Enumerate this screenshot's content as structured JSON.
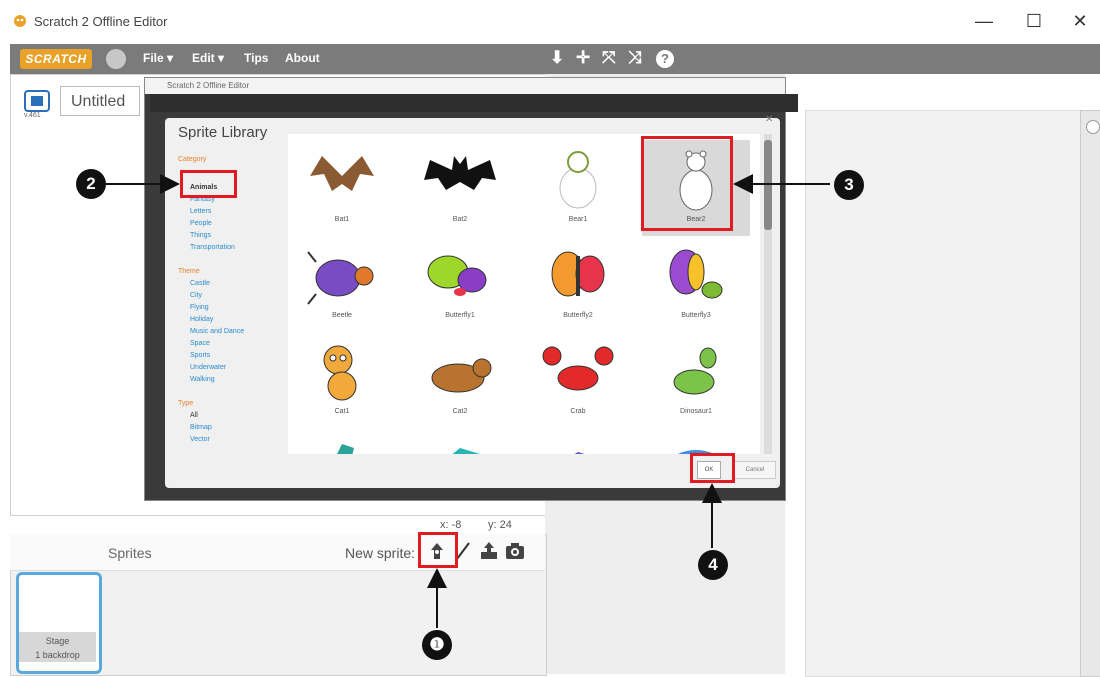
{
  "window": {
    "title": "Scratch 2 Offline Editor",
    "controls": [
      "—",
      "☐",
      "✕"
    ]
  },
  "menubar": {
    "logo": "SCRATCH",
    "items": [
      "File ▾",
      "Edit ▾",
      "Tips",
      "About"
    ],
    "tools": [
      "⬇",
      "✛",
      "⤧",
      "⤨",
      "?"
    ]
  },
  "project": {
    "title": "Untitled",
    "version": "v.461"
  },
  "inner_window": {
    "title": "Scratch 2 Offline Editor"
  },
  "dialog": {
    "title": "Sprite Library",
    "close": "✕",
    "categories": {
      "category_header": "Category",
      "category_items": [
        "Animals",
        "Fantasy",
        "Letters",
        "People",
        "Things",
        "Transportation"
      ],
      "theme_header": "Theme",
      "theme_items": [
        "Castle",
        "City",
        "Flying",
        "Holiday",
        "Music and Dance",
        "Space",
        "Sports",
        "Underwater",
        "Walking"
      ],
      "type_header": "Type",
      "type_items": [
        "All",
        "Bitmap",
        "Vector"
      ]
    },
    "sprites": [
      {
        "name": "Bat1",
        "icon": "bat-brown"
      },
      {
        "name": "Bat2",
        "icon": "bat-black"
      },
      {
        "name": "Bear1",
        "icon": "bear-outline"
      },
      {
        "name": "Bear2",
        "icon": "bear-white"
      },
      {
        "name": "Beetle",
        "icon": "beetle"
      },
      {
        "name": "Butterfly1",
        "icon": "butterfly-green"
      },
      {
        "name": "Butterfly2",
        "icon": "butterfly-orange"
      },
      {
        "name": "Butterfly3",
        "icon": "butterfly-purple"
      },
      {
        "name": "Cat1",
        "icon": "cat"
      },
      {
        "name": "Cat2",
        "icon": "cat-brown"
      },
      {
        "name": "Crab",
        "icon": "crab"
      },
      {
        "name": "Dinosaur1",
        "icon": "dinosaur"
      }
    ],
    "ok_label": "OK",
    "cancel_label": "Cancel"
  },
  "coords": {
    "x": "x: -8",
    "y": "y: 24"
  },
  "sprites_panel": {
    "label": "Sprites",
    "new_sprite_label": "New sprite:",
    "stage_label": "Stage",
    "stage_sub": "1 backdrop"
  },
  "callouts": [
    "❶",
    "2",
    "3",
    "4"
  ]
}
